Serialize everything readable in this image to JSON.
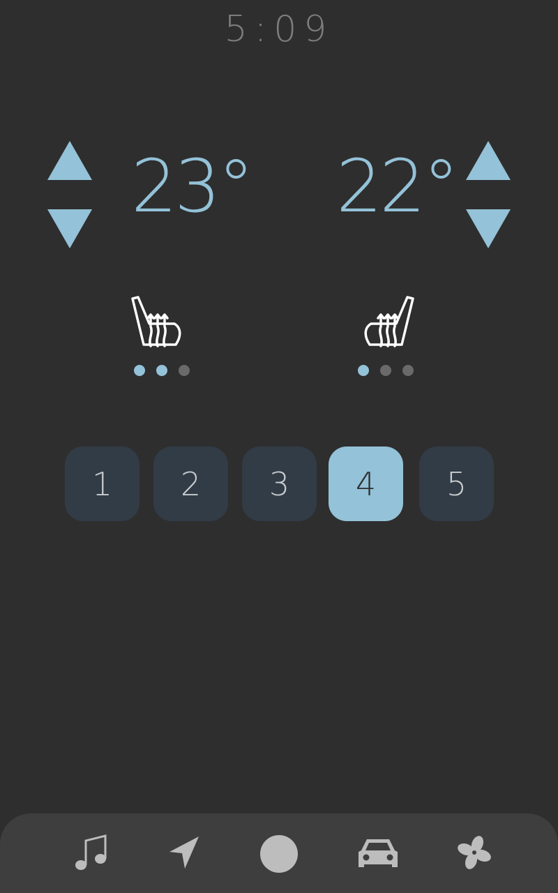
{
  "clock": {
    "time": "5:09"
  },
  "climate": {
    "left": {
      "temperature": "23°",
      "seat_heat_level": 2,
      "seat_heat_max": 3
    },
    "right": {
      "temperature": "22°",
      "seat_heat_level": 1,
      "seat_heat_max": 3
    }
  },
  "fan": {
    "levels": [
      "1",
      "2",
      "3",
      "4",
      "5"
    ],
    "selected": "4"
  },
  "nav": {
    "items": [
      {
        "icon": "music-note-icon"
      },
      {
        "icon": "navigation-arrow-icon"
      },
      {
        "icon": "home-circle-icon"
      },
      {
        "icon": "car-icon"
      },
      {
        "icon": "fan-icon"
      }
    ]
  },
  "colors": {
    "background": "#2e2e2e",
    "accent": "#94c2d8",
    "inactive_dot": "#6a6a6a",
    "fan_button_bg": "#323c46",
    "nav_bar_bg": "#3e3e3e",
    "nav_icon": "#bdbdbd"
  }
}
